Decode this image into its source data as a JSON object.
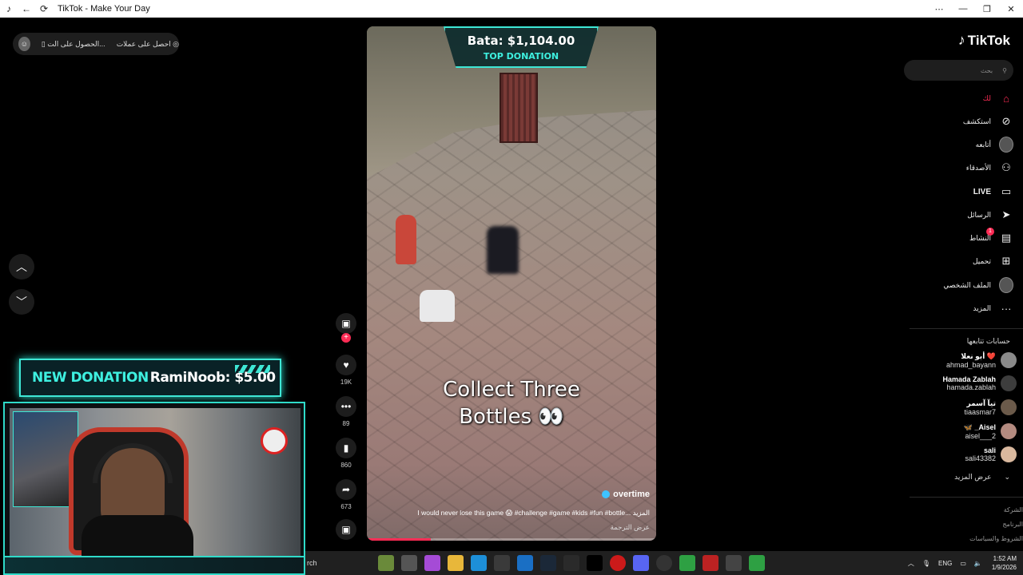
{
  "window": {
    "title": "TikTok - Make Your Day",
    "controls": [
      "⋯",
      "—",
      "❐",
      "✕"
    ]
  },
  "top_pill": {
    "get_coins": "احصل على عملات",
    "get_app": "الحصول على الت..."
  },
  "donations": {
    "banner_label": "NEW DONATION",
    "banner_text": "RamiNoob: $5.00",
    "top_amount": "Bata: $1,104.00",
    "top_label": "TOP DONATION"
  },
  "video": {
    "caption_line1": "Collect Three",
    "caption_line2": "Bottles 👀",
    "creator": "overtime",
    "description": "I would never lose this game 😱 #challenge #game #kids #fun #bottle... المزيد",
    "translate": "عرض الترجمة",
    "progress": 0.22
  },
  "actions": {
    "likes": "19K",
    "comments": "89",
    "saves": "860",
    "shares": "673"
  },
  "sidebar": {
    "brand": "TikTok",
    "search_placeholder": "بحث",
    "nav": {
      "foryou": "لك",
      "explore": "استكشف",
      "following": "أتابعه",
      "friends": "الأصدقاء",
      "live": "LIVE",
      "messages": "الرسائل",
      "activity": "النشاط",
      "upload": "تحميل",
      "profile": "الملف الشخصي",
      "more": "المزيد"
    },
    "activity_badge": "1",
    "following_title": "حسابات تتابعها",
    "accounts": [
      {
        "name": "أبو نعلا ❤️",
        "user": "ahmad_bayann"
      },
      {
        "name": "Hamada Zablah",
        "user": "hamada.zablah"
      },
      {
        "name": "تيآ آسمر",
        "user": "tiaasmar7"
      },
      {
        "name": "🦋 _Aisel",
        "user": "aisel___2"
      },
      {
        "name": "sali",
        "user": "sali43382"
      }
    ],
    "see_more": "عرض المزيد",
    "footer": [
      "الشركة",
      "البرنامج",
      "الشروط والسياسات"
    ]
  },
  "taskbar": {
    "search_fragment": "rch",
    "lang": "ENG",
    "time": "1:52 AM",
    "date": "1/9/2026"
  },
  "colors": {
    "accent": "#fe2c55",
    "stream_cyan": "#3ee7d5"
  }
}
